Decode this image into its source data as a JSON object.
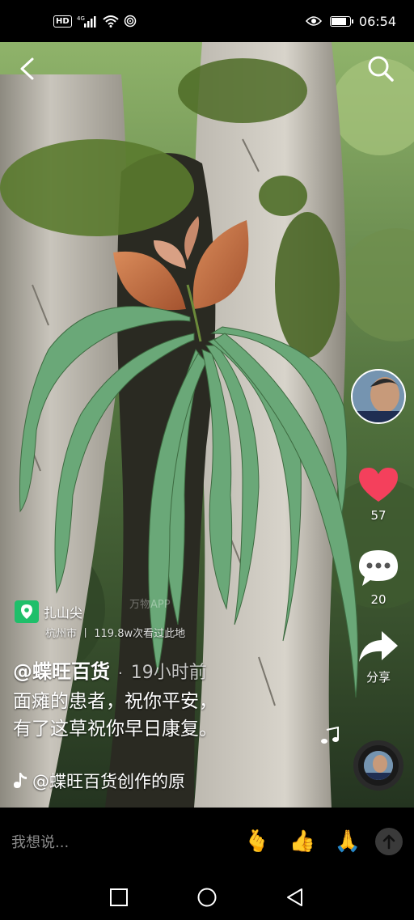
{
  "status_bar": {
    "hd_badge": "HD",
    "network": "4G",
    "time": "06:54",
    "battery_level": 0.85
  },
  "video": {
    "watermark": "万物APP"
  },
  "right_rail": {
    "like_count": "57",
    "comment_count": "20",
    "share_label": "分享"
  },
  "location": {
    "name": "扎山尖",
    "detail": "杭州市 丨 119.8w次看过此地"
  },
  "post": {
    "author": "@蝶旺百货",
    "separator": "·",
    "time_ago": "19小时前",
    "description_line1": "面瘫的患者，祝你平安，",
    "description_line2": "有了这草祝你早日康复。",
    "music": "@蝶旺百货创作的原"
  },
  "comment_bar": {
    "placeholder": "我想说...",
    "emojis": [
      "🫰",
      "👍",
      "🙏"
    ]
  },
  "colors": {
    "like_heart": "#f4405c",
    "location_pin": "#1fbf6a"
  }
}
